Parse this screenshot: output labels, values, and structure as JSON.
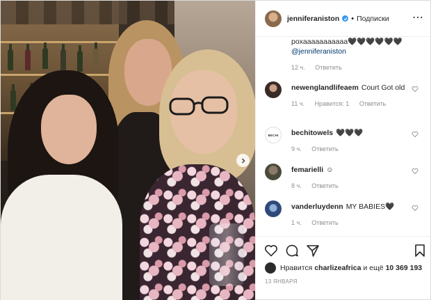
{
  "header": {
    "username": "jenniferaniston",
    "separator": "•",
    "follow_label": "Подписки",
    "more_label": "⋯"
  },
  "caption": {
    "text": "poxaaaaaaaaaaa🖤🖤🖤🖤🖤🖤",
    "mention": "@jenniferaniston",
    "time": "12 ч.",
    "reply_label": "Ответить"
  },
  "comments": [
    {
      "user": "newenglandlifeaem",
      "text": "Court Got old",
      "time": "11 ч.",
      "likes": "Нравится: 1",
      "reply_label": "Ответить"
    },
    {
      "user": "bechitowels",
      "text": "🖤🖤🖤",
      "time": "9 ч.",
      "reply_label": "Ответить",
      "avatar_text": "BECHI"
    },
    {
      "user": "femarielli",
      "text": "☺",
      "time": "8 ч.",
      "reply_label": "Ответить"
    },
    {
      "user": "vanderluydenn",
      "text": "MY BABIES🖤",
      "time": "1 ч.",
      "reply_label": "Ответить"
    }
  ],
  "likes": {
    "prefix": "Нравится",
    "user": "charlizeafrica",
    "suffix": "и ещё",
    "count": "10 369 193"
  },
  "date": "13 ЯНВАРЯ",
  "colors": {
    "link": "#00376b",
    "muted": "#8e8e8e",
    "verified": "#3897f0"
  },
  "icons": [
    "heart-icon",
    "comment-icon",
    "share-icon",
    "save-icon",
    "more-icon",
    "next-icon",
    "verified-icon"
  ]
}
